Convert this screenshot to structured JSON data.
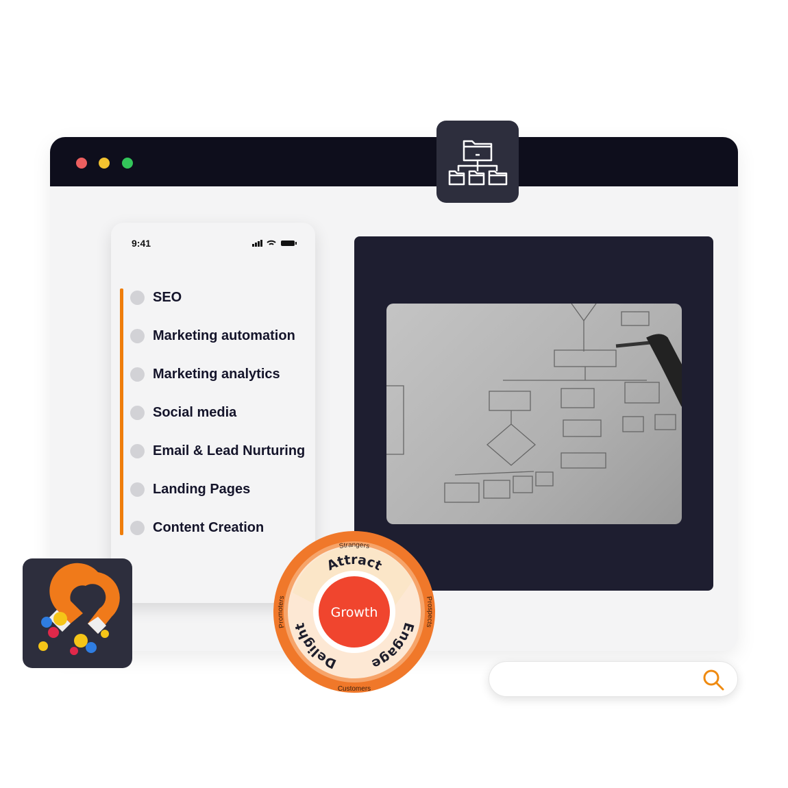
{
  "window": {
    "traffic_lights": [
      "#ec5f5f",
      "#f2c230",
      "#33c55a"
    ]
  },
  "folder_tile": {
    "icon": "folder-hierarchy-icon"
  },
  "phone": {
    "status_time": "9:41",
    "status_icons": [
      "signal-icon",
      "wifi-icon",
      "battery-icon"
    ],
    "accent": "#ef7d0a",
    "items": [
      {
        "label": "SEO"
      },
      {
        "label": "Marketing automation"
      },
      {
        "label": "Marketing analytics"
      },
      {
        "label": "Social media"
      },
      {
        "label": "Email & Lead Nurturing"
      },
      {
        "label": "Landing Pages"
      },
      {
        "label": "Content Creation"
      }
    ]
  },
  "flywheel": {
    "center": "Growth",
    "stages": [
      "Attract",
      "Engage",
      "Delight"
    ],
    "outer": [
      "Strangers",
      "Prospects",
      "Customers",
      "Promoters"
    ]
  },
  "magnet_tile": {
    "icon": "magnet-icon"
  },
  "search": {
    "placeholder": "",
    "icon": "search-icon",
    "icon_color": "#ef8a10"
  }
}
